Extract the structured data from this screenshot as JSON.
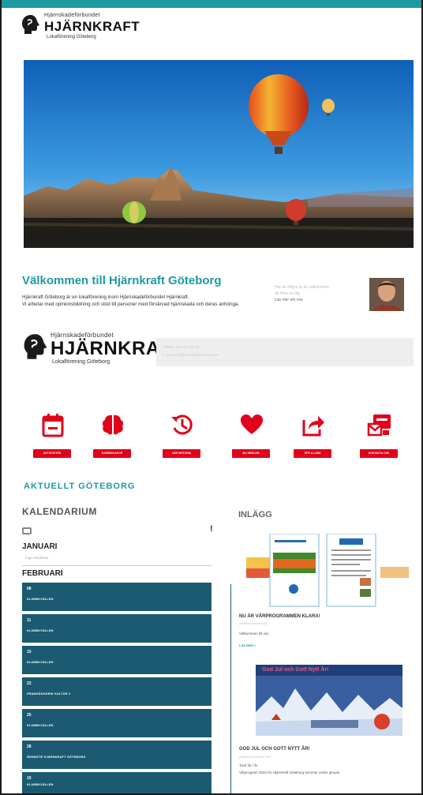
{
  "header": {
    "logo_small": "Hjärnskadeförbundet",
    "logo_big": "HJÄRNKRAFT",
    "logo_sub": "Lokalförening Göteborg"
  },
  "welcome": {
    "title": "Välkommen till Hjärnkraft Göteborg",
    "line1": "Hjärnkraft Göteborg är en lokalförening inom Hjärnskadeförbundet Hjärnkraft.",
    "line2": "Vi arbetar med opinionsbildning och stöd till personer med förvärvad hjärnskada och deras anhöriga.",
    "contact_line1": "Har du frågor är du välkommen",
    "contact_line2": "att höra av dig",
    "contact_line3": "Läs mer om oss"
  },
  "logo2": {
    "small": "Hjärnskadeförbundet",
    "big": "HJÄRNKRAFT",
    "sub": "Lokalförening Göteborg",
    "box_line1": "Telefon: 031-XX XX XX",
    "box_line2": "E-post: info@hjarnkraftgoteborg.se"
  },
  "features": [
    {
      "label": "AKTIVITETER",
      "icon": "calendar-minus-icon"
    },
    {
      "label": "HJÄRNSKADOR",
      "icon": "brain-icon"
    },
    {
      "label": "VÅR HISTORIA",
      "icon": "history-icon"
    },
    {
      "label": "BLI MEDLEM",
      "icon": "heart-icon"
    },
    {
      "label": "TIPS & LÄNK",
      "icon": "share-icon"
    },
    {
      "label": "KONTAKTA OSS",
      "icon": "mail-contact-icon"
    }
  ],
  "section_title": "AKTUELLT GÖTEBORG",
  "calendar": {
    "title": "KALENDARIUM",
    "more": "!",
    "jan": "JANUARI",
    "jan_sub": "Inga händelser",
    "feb": "FEBRUARI",
    "events": [
      {
        "date": "08",
        "name": "KLUBBKVÄLLEN"
      },
      {
        "date": "11",
        "name": "KLUBBKVÄLLEN"
      },
      {
        "date": "15",
        "name": "KLUBBKVÄLLEN"
      },
      {
        "date": "22",
        "name": "FRAMGÅNGSRIK KULTUR 2"
      },
      {
        "date": "25",
        "name": "KLUBBKVÄLLEN"
      },
      {
        "date": "28",
        "name": "ÅRSMÖTE HJÄRNKRAFT GÖTEBORG"
      },
      {
        "date": "15",
        "name": "KLUBBKVÄLLEN"
      }
    ]
  },
  "posts": {
    "title": "INLÄGG",
    "post1_title": "NU ÄR VÅRPROGRAMMEN KLARA!",
    "post1_meta": "publicerat januari 2022",
    "post1_text": "Välkommen till oss",
    "post1_more": "LÄS MER »",
    "post2_title": "GOD JUL OCH GOTT NYTT ÅR!",
    "post2_meta": "publicerat december 2021",
    "post2_text1": "Tack för i år.",
    "post2_text2": "Vårprogram 2022 för Hjärnkraft Göteborg kommer under januari.",
    "card_banner": "God Jul och Gott Nytt År!"
  },
  "colors": {
    "accent": "#1e9aa0",
    "red": "#e2001a",
    "navy": "#1b5a70"
  }
}
